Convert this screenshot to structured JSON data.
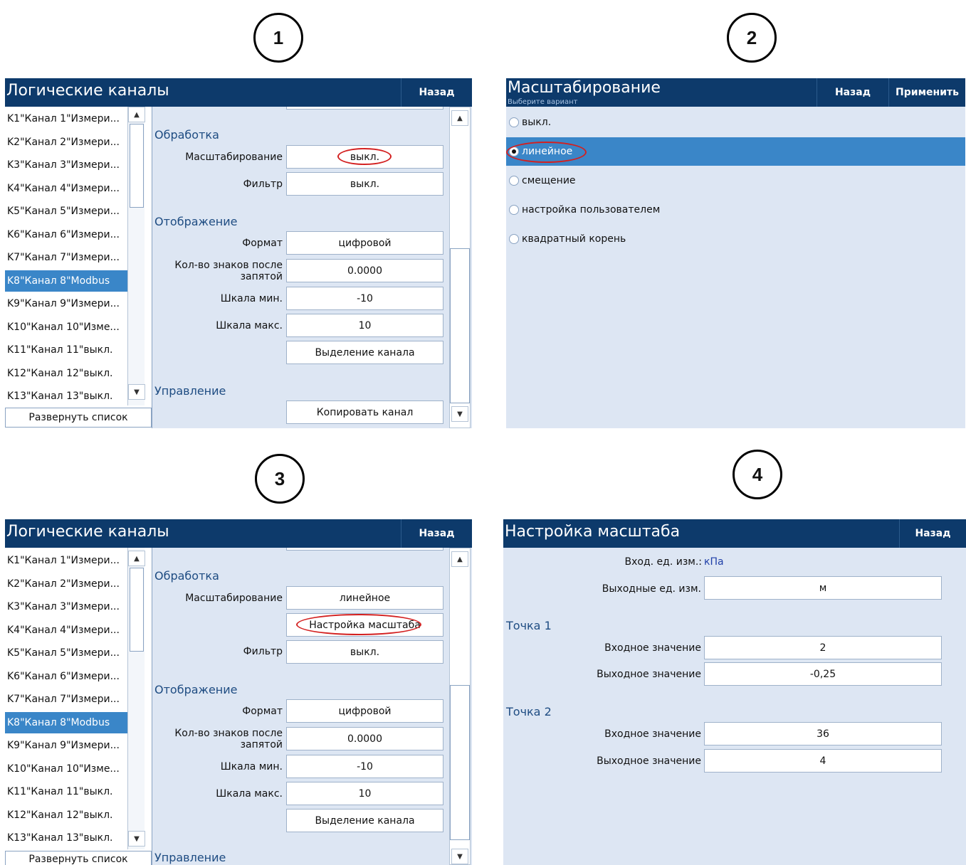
{
  "markers": [
    "1",
    "2",
    "3",
    "4"
  ],
  "panel1": {
    "title": "Логические каналы",
    "back": "Назад",
    "channels": [
      "K1\"Канал 1\"Измери...",
      "K2\"Канал 2\"Измери...",
      "K3\"Канал 3\"Измери...",
      "K4\"Канал 4\"Измери...",
      "K5\"Канал 5\"Измери...",
      "K6\"Канал 6\"Измери...",
      "K7\"Канал 7\"Измери...",
      "K8\"Канал 8\"Modbus",
      "K9\"Канал 9\"Измери...",
      "K10\"Канал 10\"Изме...",
      "K11\"Канал 11\"выкл.",
      "K12\"Канал 12\"выкл.",
      "K13\"Канал 13\"выкл."
    ],
    "selected_channel": "K8\"Канал 8\"Modbus",
    "expand": "Развернуть список",
    "sec_processing": "Обработка",
    "scaling_label": "Масштабирование",
    "scaling_value": "выкл.",
    "filter_label": "Фильтр",
    "filter_value": "выкл.",
    "sec_display": "Отображение",
    "format_label": "Формат",
    "format_value": "цифровой",
    "decimals_label_1": "Кол-во знаков после",
    "decimals_label_2": "запятой",
    "decimals_value": "0.0000",
    "scale_min_label": "Шкала мин.",
    "scale_min_value": "-10",
    "scale_max_label": "Шкала макс.",
    "scale_max_value": "10",
    "highlight_btn": "Выделение канала",
    "sec_control": "Управление",
    "copy_btn": "Копировать канал"
  },
  "panel2": {
    "title": "Масштабирование",
    "subtitle": "Выберите вариант",
    "back": "Назад",
    "apply": "Применить",
    "options": [
      "выкл.",
      "линейное",
      "смещение",
      "настройка пользователем",
      "квадратный корень"
    ],
    "selected": "линейное"
  },
  "panel3": {
    "title": "Логические каналы",
    "back": "Назад",
    "expand": "Развернуть список",
    "sec_processing": "Обработка",
    "scaling_label": "Масштабирование",
    "scaling_value": "линейное",
    "scale_setup_btn": "Настройка масштаба",
    "filter_label": "Фильтр",
    "filter_value": "выкл.",
    "sec_display": "Отображение",
    "format_label": "Формат",
    "format_value": "цифровой",
    "decimals_label_1": "Кол-во знаков после",
    "decimals_label_2": "запятой",
    "decimals_value": "0.0000",
    "scale_min_label": "Шкала мин.",
    "scale_min_value": "-10",
    "scale_max_label": "Шкала макс.",
    "scale_max_value": "10",
    "highlight_btn": "Выделение канала",
    "sec_control": "Управление"
  },
  "panel4": {
    "title": "Настройка масштаба",
    "back": "Назад",
    "input_unit_label": "Вход. ед. изм.:",
    "input_unit_value": "кПа",
    "output_unit_label": "Выходные ед. изм.",
    "output_unit_value": "м",
    "point1": "Точка 1",
    "point2": "Точка 2",
    "in_label": "Входное значение",
    "out_label": "Выходное значение",
    "p1_in": "2",
    "p1_out": "-0,25",
    "p2_in": "36",
    "p2_out": "4"
  }
}
